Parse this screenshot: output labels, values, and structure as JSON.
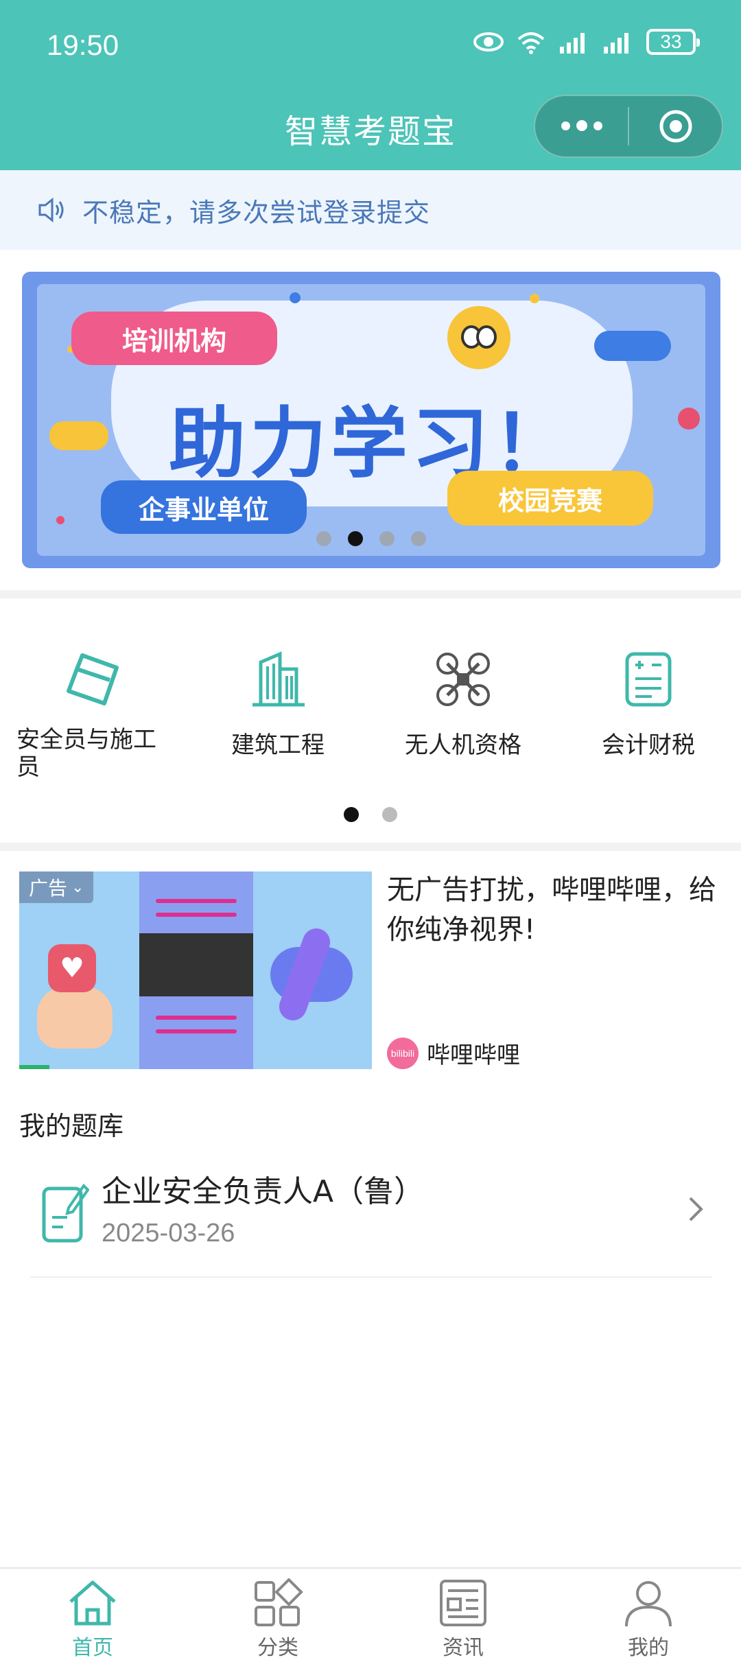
{
  "status_bar": {
    "time": "19:50",
    "battery": "33"
  },
  "header": {
    "title": "智慧考题宝"
  },
  "notice": {
    "text": "不稳定，请多次尝试登录提交"
  },
  "banner": {
    "main_text": "助力学习！",
    "tags": [
      "培训机构",
      "企事业单位",
      "校园竞赛"
    ],
    "slide_count": 4,
    "active_slide": 2
  },
  "categories": {
    "items": [
      {
        "label": "安全员与施工员",
        "icon": "pencil-box-icon"
      },
      {
        "label": "建筑工程",
        "icon": "building-icon"
      },
      {
        "label": "无人机资格",
        "icon": "drone-icon"
      },
      {
        "label": "会计财税",
        "icon": "calculator-icon"
      }
    ],
    "page_count": 2,
    "active_page": 1
  },
  "ad": {
    "badge": "广告",
    "title": "无广告打扰，哔哩哔哩，给你纯净视界!",
    "source": "哔哩哔哩",
    "source_logo_text": "bilibili"
  },
  "my_bank": {
    "title": "我的题库",
    "items": [
      {
        "name": "企业安全负责人A（鲁）",
        "date": "2025-03-26"
      }
    ]
  },
  "tabbar": {
    "items": [
      {
        "label": "首页",
        "icon": "home-icon",
        "active": true
      },
      {
        "label": "分类",
        "icon": "category-icon",
        "active": false
      },
      {
        "label": "资讯",
        "icon": "news-icon",
        "active": false
      },
      {
        "label": "我的",
        "icon": "user-icon",
        "active": false
      }
    ]
  },
  "colors": {
    "primary": "#4cc4b7",
    "notice_text": "#4a78b8",
    "tab_active": "#3fb8ab"
  }
}
